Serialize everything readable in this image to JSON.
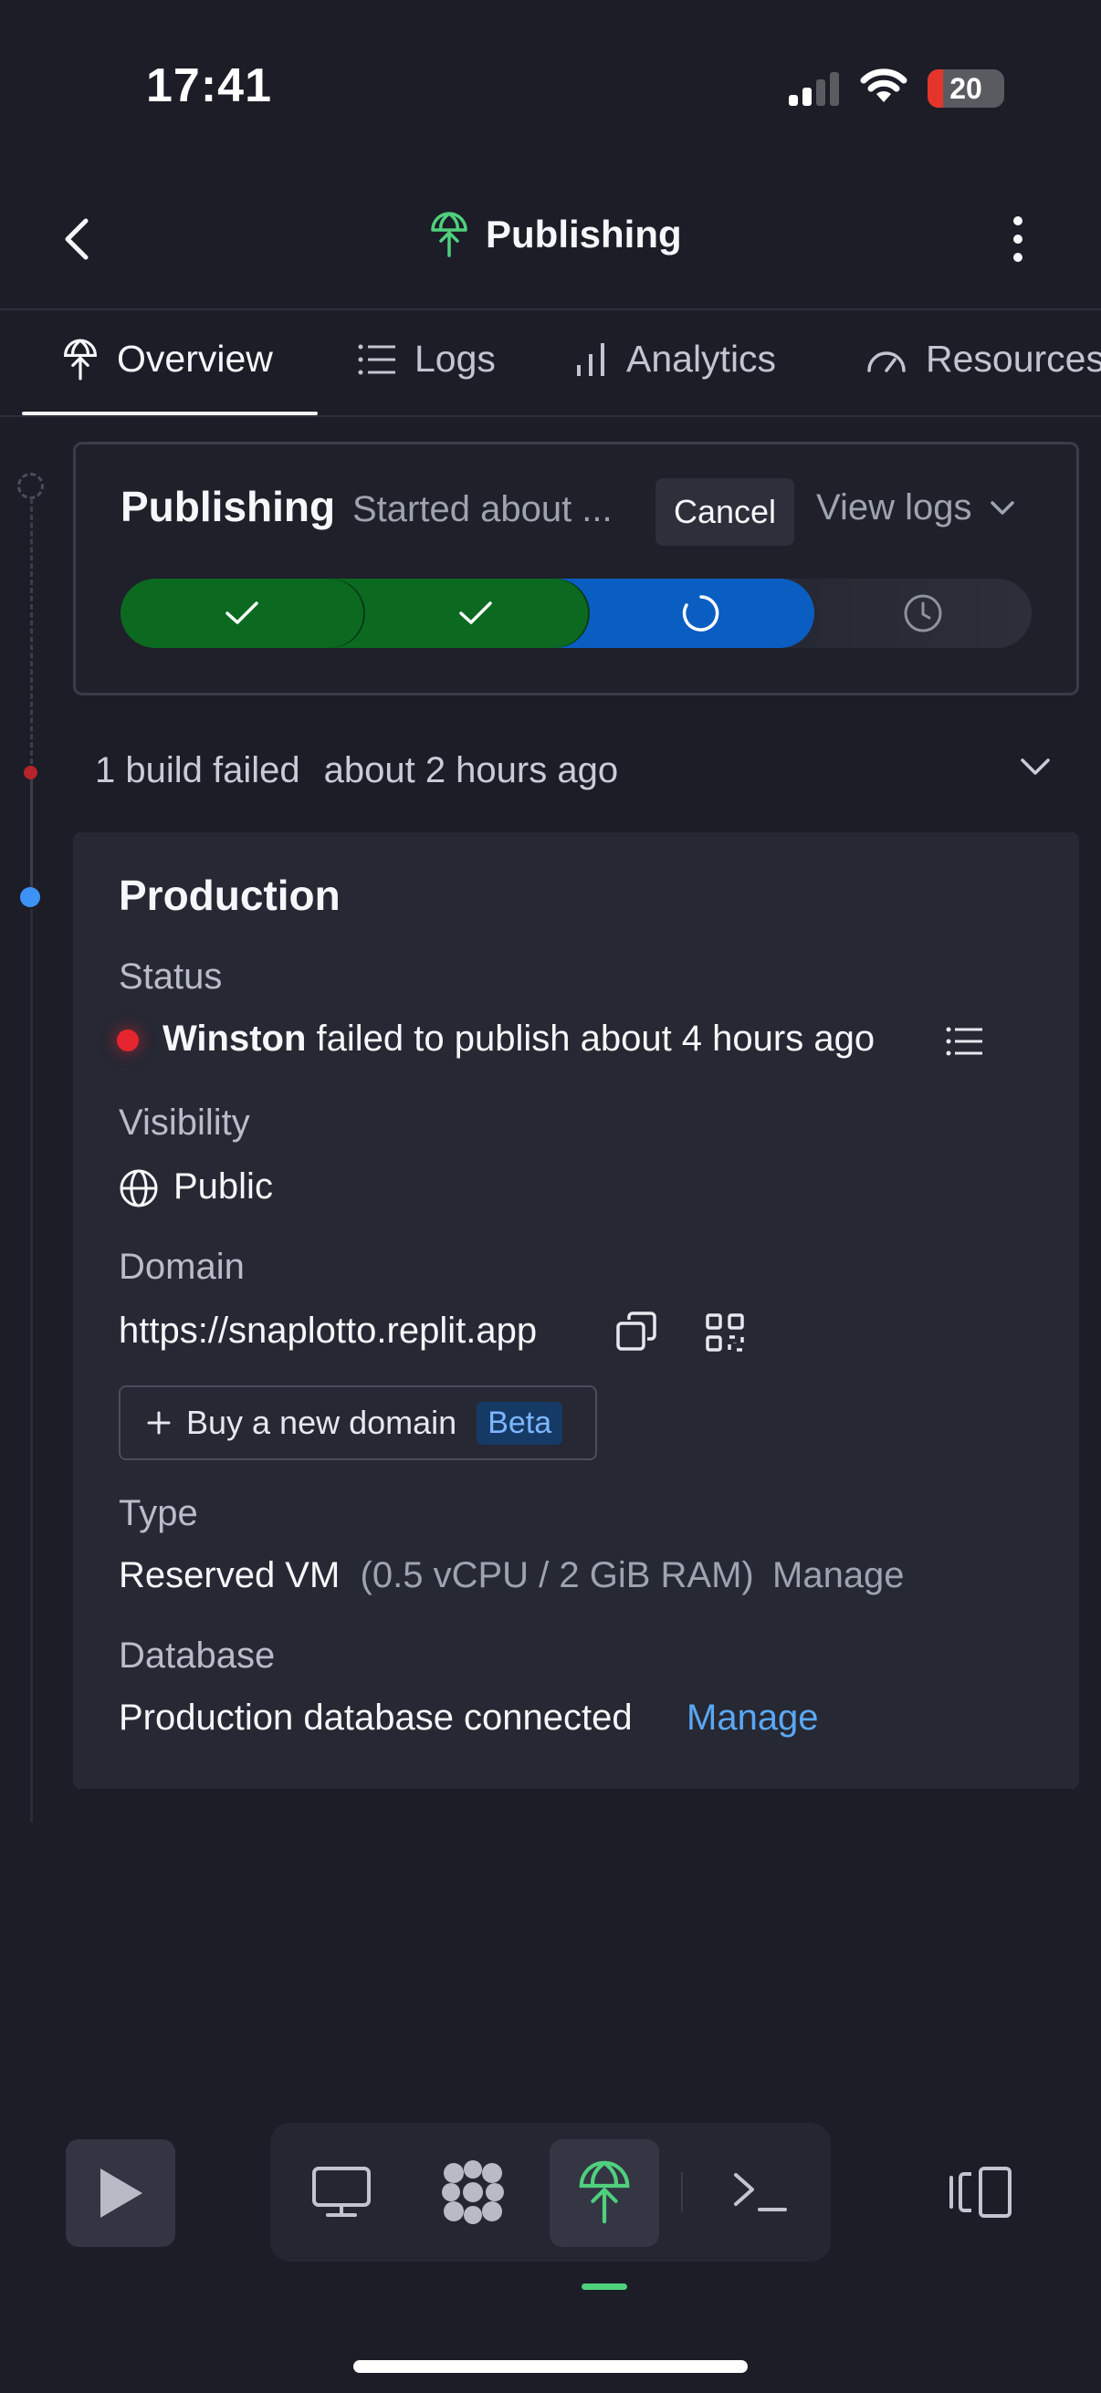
{
  "status_bar": {
    "time": "17:41",
    "battery": "20"
  },
  "header": {
    "title": "Publishing"
  },
  "tabs": [
    {
      "label": "Overview",
      "icon": "publish-icon",
      "active": true
    },
    {
      "label": "Logs",
      "icon": "list-icon"
    },
    {
      "label": "Analytics",
      "icon": "bar-chart-icon"
    },
    {
      "label": "Resources",
      "icon": "gauge-icon"
    }
  ],
  "publishing_card": {
    "title": "Publishing",
    "started": "Started about ...",
    "cancel_label": "Cancel",
    "view_logs_label": "View logs",
    "steps": [
      {
        "state": "done",
        "icon": "check-icon"
      },
      {
        "state": "done",
        "icon": "check-icon"
      },
      {
        "state": "in-progress",
        "icon": "spinner-icon"
      },
      {
        "state": "pending",
        "icon": "clock-icon"
      }
    ]
  },
  "build_failed": {
    "count_text": "1 build failed",
    "time_text": "about 2 hours ago"
  },
  "production": {
    "title": "Production",
    "status_label": "Status",
    "status_user": "Winston",
    "status_text": "failed to publish about 4 hours ago",
    "visibility_label": "Visibility",
    "visibility_value": "Public",
    "domain_label": "Domain",
    "domain_value": "https://snaplotto.replit.app",
    "buy_domain_label": "Buy a new domain",
    "beta_label": "Beta",
    "type_label": "Type",
    "type_value": "Reserved VM",
    "type_specs": "(0.5 vCPU / 2 GiB RAM)",
    "type_manage": "Manage",
    "database_label": "Database",
    "database_value": "Production database connected",
    "database_manage": "Manage"
  },
  "colors": {
    "background": "#1c1d27",
    "success": "#0b6a20",
    "progress": "#0a5ec2",
    "error": "#e5252f",
    "link": "#5aa8f5",
    "publish_accent": "#4fd07d"
  }
}
